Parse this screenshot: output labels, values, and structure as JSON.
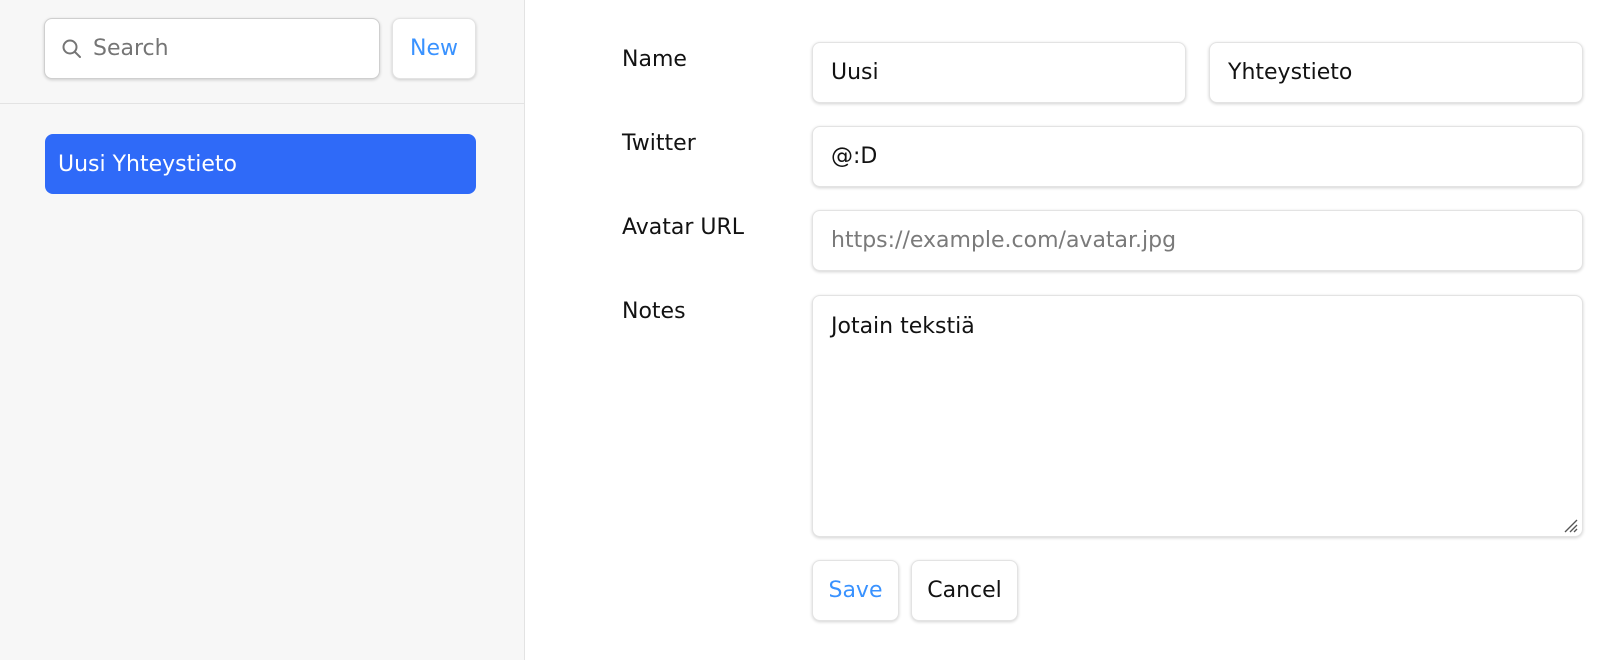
{
  "sidebar": {
    "search": {
      "placeholder": "Search",
      "value": ""
    },
    "new_label": "New",
    "contacts": [
      {
        "name": "Uusi Yhteystieto",
        "active": true
      }
    ]
  },
  "form": {
    "name_label": "Name",
    "first_name": "Uusi",
    "last_name": "Yhteystieto",
    "twitter_label": "Twitter",
    "twitter": "@:D",
    "avatar_label": "Avatar URL",
    "avatar_placeholder": "https://example.com/avatar.jpg",
    "avatar_value": "",
    "notes_label": "Notes",
    "notes": "Jotain tekstiä",
    "save_label": "Save",
    "cancel_label": "Cancel"
  },
  "colors": {
    "accent": "#3992ff",
    "active_item": "#2f6af8",
    "sidebar_bg": "#f7f7f7"
  },
  "icons": {
    "search": "search-icon",
    "resize": "resize-handle-icon"
  }
}
